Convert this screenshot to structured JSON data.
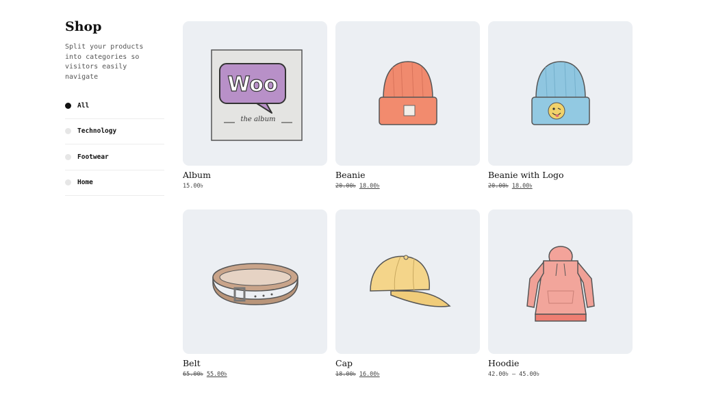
{
  "sidebar": {
    "title": "Shop",
    "description": "Split your products into categories so visitors easily navigate",
    "categories": [
      {
        "label": "All",
        "active": true
      },
      {
        "label": "Technology",
        "active": false
      },
      {
        "label": "Footwear",
        "active": false
      },
      {
        "label": "Home",
        "active": false
      }
    ]
  },
  "products": [
    {
      "name": "Album",
      "price": "15.00৳",
      "icon": "album-image"
    },
    {
      "name": "Beanie",
      "old_price": "20.00৳",
      "price": "18.00৳",
      "icon": "beanie-image"
    },
    {
      "name": "Beanie with Logo",
      "old_price": "20.00৳",
      "price": "18.00৳",
      "icon": "beanie-logo-image"
    },
    {
      "name": "Belt",
      "old_price": "65.00৳",
      "price": "55.00৳",
      "icon": "belt-image"
    },
    {
      "name": "Cap",
      "old_price": "18.00৳",
      "price": "16.00৳",
      "icon": "cap-image"
    },
    {
      "name": "Hoodie",
      "price_range": "42.00৳ – 45.00৳",
      "icon": "hoodie-image"
    }
  ],
  "album_art": {
    "logo_text": "Woo",
    "subtitle": "the album"
  },
  "colors": {
    "card_bg": "#eceff3",
    "active_dot": "#111111",
    "inactive_dot": "#e6e6e6"
  }
}
